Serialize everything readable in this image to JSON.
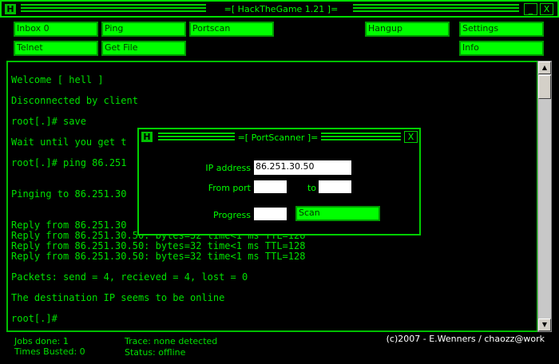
{
  "window": {
    "title": "=[ HackTheGame 1.21 ]=",
    "logo": "H",
    "minimize": "_",
    "close": "X"
  },
  "buttons": {
    "inbox": "Inbox 0",
    "ping": "Ping",
    "portscan": "Portscan",
    "hangup": "Hangup",
    "settings": "Settings",
    "telnet": "Telnet",
    "get_file": "Get File",
    "info": "Info"
  },
  "terminal": {
    "lines": [
      "Welcome [ hell ]",
      "Disconnected by client",
      "root[.]# save",
      "Wait until you get t",
      "root[.]# ping 86.251",
      "Pinging to 86.251.30",
      "Reply from 86.251.30",
      "Reply from 86.251.30.50: bytes=32 time<1 ms TTL=128",
      "Reply from 86.251.30.50: bytes=32 time<1 ms TTL=128",
      "Reply from 86.251.30.50: bytes=32 time<1 ms TTL=128",
      "Packets: send = 4, recieved = 4, lost = 0",
      "The destination IP seems to be online",
      "root[.]#"
    ]
  },
  "portscanner": {
    "title": "=[ PortScanner ]=",
    "logo": "H",
    "close": "X",
    "ip_label": "IP address",
    "ip_value": "86.251.30.50",
    "from_port_label": "From port",
    "from_port_value": "",
    "to_label": "to",
    "to_value": "",
    "progress_label": "Progress",
    "progress_value": "",
    "scan_button": "Scan"
  },
  "statusbar": {
    "jobs_done": "Jobs done: 1",
    "times_busted": "Times Busted: 0",
    "trace": "Trace: none detected",
    "status": "Status: offline",
    "copyright": "(c)2007 - E.Wenners / chaozz@work"
  },
  "scrollbar": {
    "up_arrow": "▲",
    "down_arrow": "▼"
  },
  "colors": {
    "accent": "#00ff00",
    "background": "#000000"
  }
}
